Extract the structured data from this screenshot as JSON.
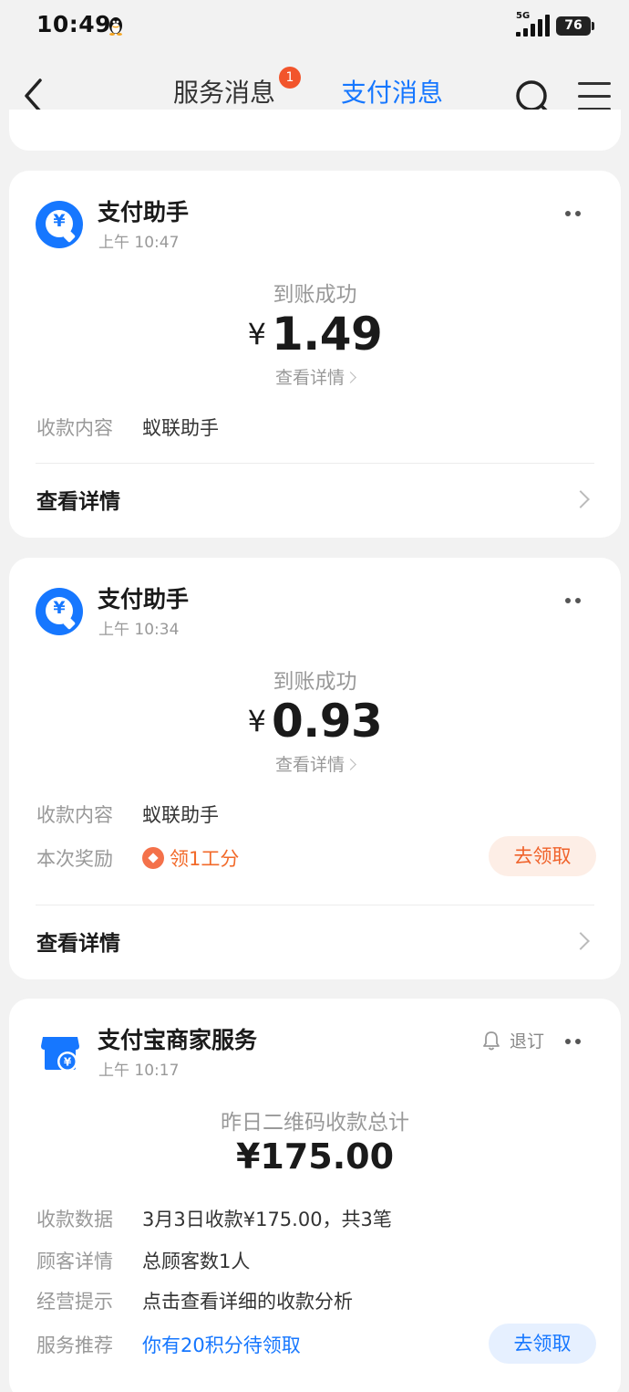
{
  "status_bar": {
    "time": "10:49",
    "network": "5G",
    "battery": "76"
  },
  "nav": {
    "tabs": [
      {
        "label": "服务消息",
        "badge": "1"
      },
      {
        "label": "支付消息"
      }
    ],
    "active_tab": "支付消息",
    "accent_color": "#1677ff"
  },
  "cards": [
    {
      "sender": "支付助手",
      "time": "上午 10:47",
      "status": "到账成功",
      "currency": "¥",
      "amount": "1.49",
      "detail_link": "查看详情",
      "rows": [
        {
          "label": "收款内容",
          "value": "蚁联助手"
        }
      ],
      "footer_label": "查看详情"
    },
    {
      "sender": "支付助手",
      "time": "上午 10:34",
      "status": "到账成功",
      "currency": "¥",
      "amount": "0.93",
      "detail_link": "查看详情",
      "rows": [
        {
          "label": "收款内容",
          "value": "蚁联助手"
        },
        {
          "label": "本次奖励",
          "value": "领1工分",
          "action": "去领取"
        }
      ],
      "footer_label": "查看详情"
    },
    {
      "sender": "支付宝商家服务",
      "time": "上午 10:17",
      "unsubscribe": "退订",
      "status": "昨日二维码收款总计",
      "amount": "¥175.00",
      "rows": [
        {
          "label": "收款数据",
          "value": "3月3日收款¥175.00，共3笔"
        },
        {
          "label": "顾客详情",
          "value": "总顾客数1人"
        },
        {
          "label": "经营提示",
          "value": "点击查看详细的收款分析"
        },
        {
          "label": "服务推荐",
          "value": "你有20积分待领取",
          "action": "去领取"
        }
      ]
    }
  ]
}
